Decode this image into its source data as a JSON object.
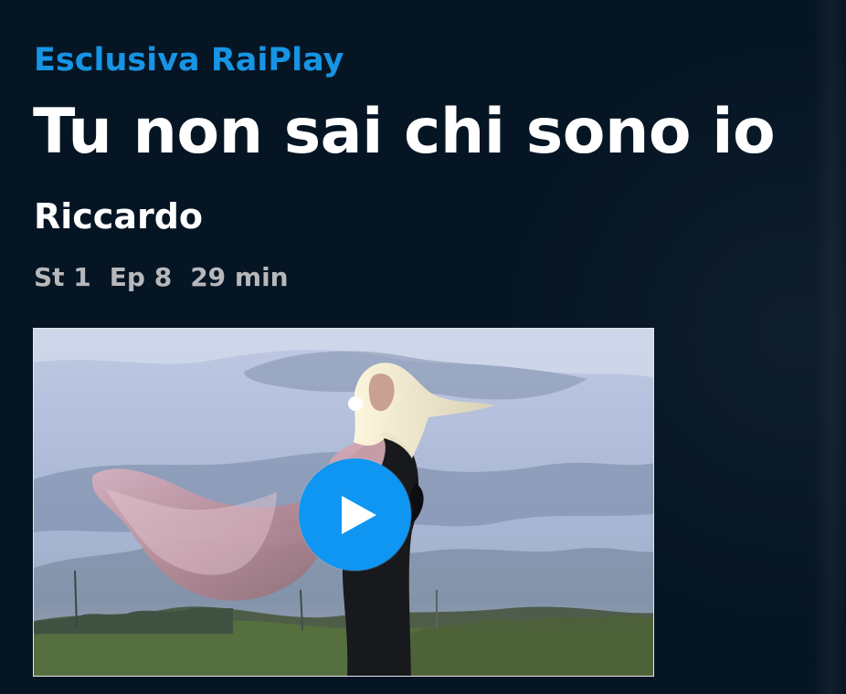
{
  "program": {
    "label": "Esclusiva RaiPlay",
    "title": "Tu non sai chi sono io",
    "episode_title": "Riccardo"
  },
  "meta": {
    "season": "St 1",
    "episode": "Ep 8",
    "duration": "29 min"
  },
  "video": {
    "play_icon": "play-icon",
    "accent": "#0f96f2"
  },
  "colors": {
    "background": "#061524",
    "brand_blue": "#1794e4",
    "meta_gray": "#b7b8bb"
  }
}
